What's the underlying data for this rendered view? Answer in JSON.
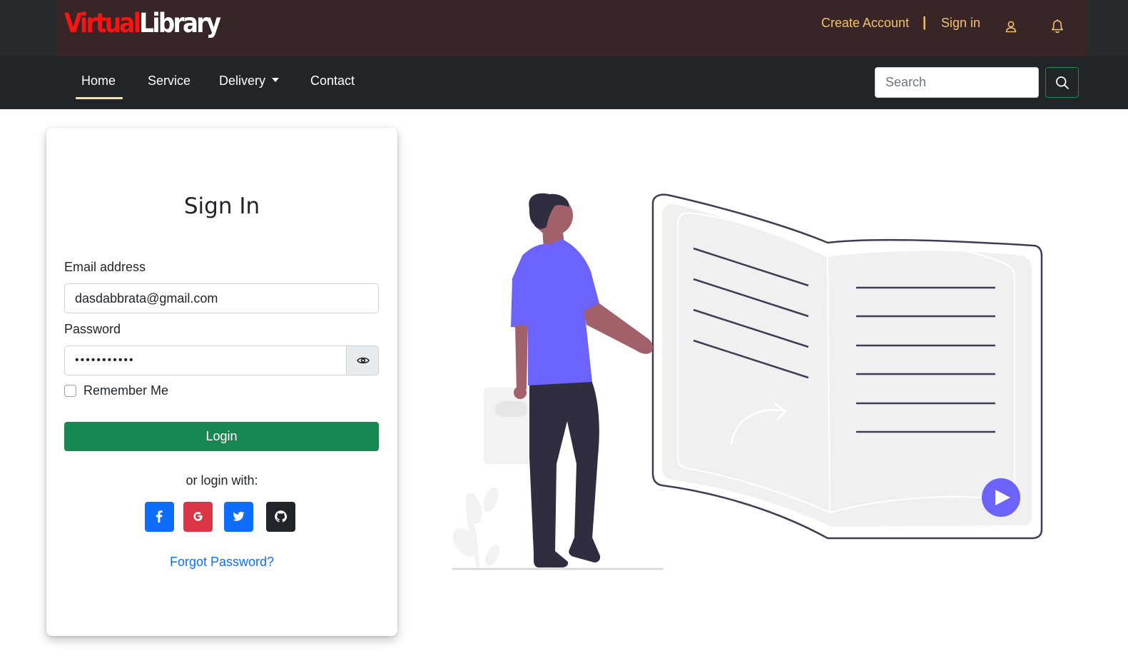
{
  "brand": {
    "logo_part1": "Virtual",
    "logo_part2": "Library"
  },
  "top_nav": {
    "create_account": "Create Account",
    "separator": "|",
    "sign_in": "Sign in",
    "user_icon": "user-icon",
    "bell_icon": "bell-icon"
  },
  "nav": {
    "items": [
      {
        "label": "Home",
        "active": true
      },
      {
        "label": "Service"
      },
      {
        "label": "Delivery",
        "dropdown": true
      },
      {
        "label": "Contact"
      }
    ],
    "search": {
      "placeholder": "Search",
      "button_icon": "search-icon"
    }
  },
  "signin": {
    "title": "Sign In",
    "email_label": "Email address",
    "email_value": "dasdabbrata@gmail.com",
    "password_label": "Password",
    "password_value": "•••••••••••",
    "password_toggle_icon": "eye-icon",
    "remember_label": "Remember Me",
    "remember_checked": false,
    "login_button": "Login",
    "or_text": "or login with:",
    "social": [
      {
        "icon": "facebook-icon",
        "color": "#0d6efd"
      },
      {
        "icon": "google-icon",
        "color": "#dc3545"
      },
      {
        "icon": "twitter-icon",
        "color": "#0d6efd"
      },
      {
        "icon": "github-icon",
        "color": "#212529"
      }
    ],
    "forgot": "Forgot Password?"
  },
  "colors": {
    "accent_gold": "#f2c06a",
    "primary_green": "#198754",
    "illustration_purple": "#6c63ff",
    "link_blue": "#0d6efd"
  }
}
